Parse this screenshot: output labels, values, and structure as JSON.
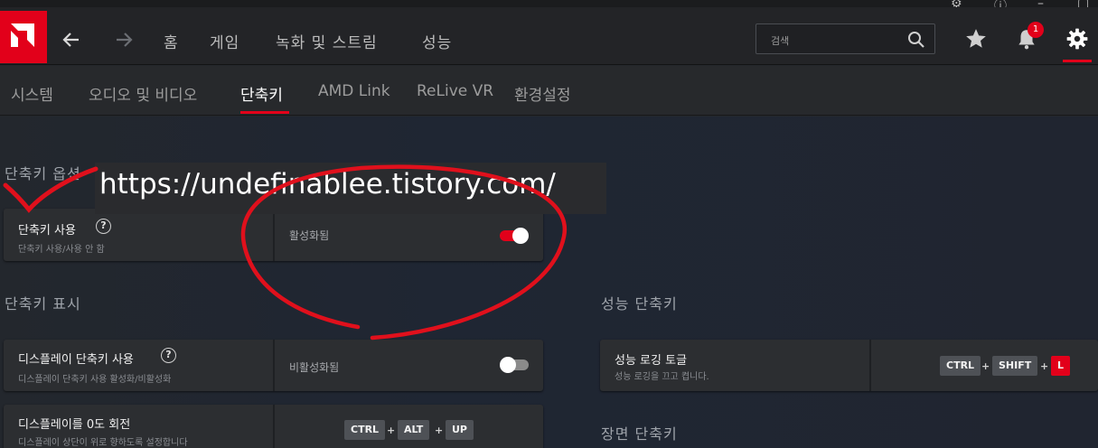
{
  "nav": {
    "links": [
      "홈",
      "게임",
      "녹화 및 스트림",
      "성능"
    ],
    "search_placeholder": "검색",
    "notification_count": "1"
  },
  "subtabs": [
    "시스템",
    "오디오 및 비디오",
    "단축키",
    "AMD Link",
    "ReLive VR",
    "환경설정"
  ],
  "active_tab": "단축키",
  "sections": {
    "options_title": "단축키 옵션",
    "display_title": "단축키 표시",
    "performance_title": "성능 단축키",
    "scene_title": "장면 단축키"
  },
  "settings": {
    "hotkey_use": {
      "title": "단축키 사용",
      "sub": "단축키 사용/사용 안 함",
      "value": "활성화됨",
      "enabled": true
    },
    "display_hotkey": {
      "title": "디스플레이 단축키 사용",
      "sub": "디스플레이 단축키 사용 활성화/비활성화",
      "value": "비활성화됨",
      "enabled": false
    },
    "rotate_display": {
      "title": "디스플레이를 0도 회전",
      "sub": "디스플레이 상단이 위로 향하도록 설정합니다",
      "keys": [
        "CTRL",
        "ALT",
        "UP"
      ]
    },
    "perf_logging": {
      "title": "성능 로깅 토글",
      "sub": "성능 로깅을 끄고 켭니다.",
      "keys": [
        "CTRL",
        "SHIFT",
        "L"
      ]
    }
  },
  "watermark": "https://undefinablee.tistory.com/",
  "colors": {
    "accent": "#e2001a",
    "annotation": "#e0101c"
  },
  "icons": [
    "amd-logo-icon",
    "back-arrow-icon",
    "forward-arrow-icon",
    "search-icon",
    "star-icon",
    "bell-icon",
    "gear-icon",
    "help-icon"
  ]
}
